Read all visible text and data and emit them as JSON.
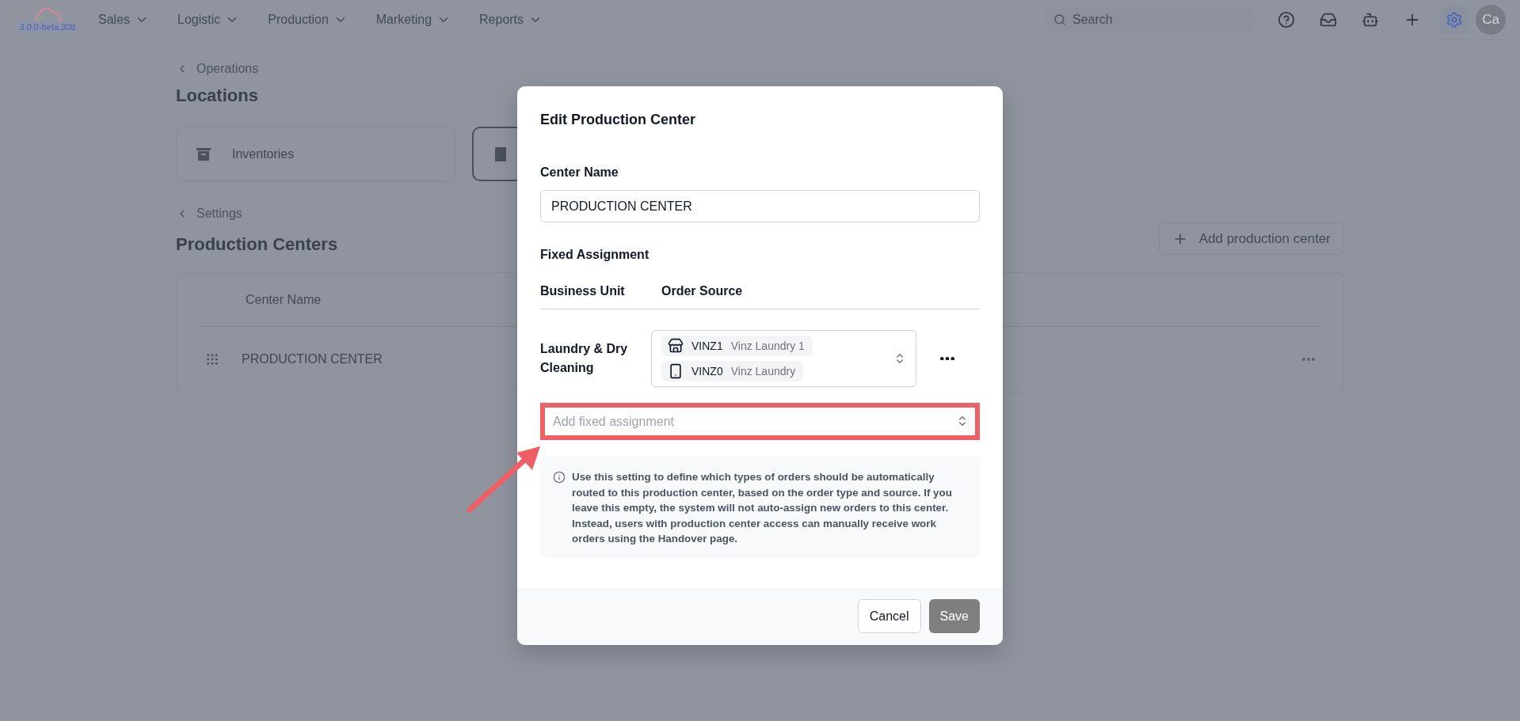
{
  "app": {
    "version": "3.0.0-beta.308"
  },
  "nav": [
    {
      "label": "Sales"
    },
    {
      "label": "Logistic"
    },
    {
      "label": "Production"
    },
    {
      "label": "Marketing"
    },
    {
      "label": "Reports"
    }
  ],
  "search": {
    "placeholder": "Search"
  },
  "toolbar": [
    {
      "selected": false
    },
    {
      "selected": false
    },
    {
      "selected": false
    },
    {
      "selected": false
    },
    {
      "selected": true
    }
  ],
  "user": {
    "initials": "Ca"
  },
  "locations": {
    "breadcrumb": "Operations",
    "title": "Locations",
    "tiles": [
      {
        "label": "Inventories",
        "selected": false
      },
      {
        "selected": true
      }
    ]
  },
  "production_centers": {
    "breadcrumb": "Settings",
    "title": "Production Centers",
    "add_button": "Add production center",
    "columns": [
      "Center Name"
    ],
    "rows": [
      {
        "name": "PRODUCTION CENTER"
      }
    ]
  },
  "dialog": {
    "title": "Edit Production Center",
    "name_label": "Center Name",
    "name_value": "PRODUCTION CENTER",
    "section": "Fixed Assignment",
    "columns": [
      "Business Unit",
      "Order Source"
    ],
    "assignments": [
      {
        "business_unit": "Laundry & Dry Cleaning",
        "sources": [
          {
            "code": "VINZ1",
            "name": "Vinz Laundry 1"
          },
          {
            "code": "VINZ0",
            "name": "Vinz Laundry"
          }
        ]
      }
    ],
    "add_placeholder": "Add fixed assignment",
    "add_highlighted": true,
    "info": "Use this setting to define which types of orders should be automatically routed to this production center, based on the order type and source. If you leave this empty, the system will not auto-assign new orders to this center. Instead, users with production center access can manually receive work orders using the Handover page.",
    "buttons": [
      {
        "label": "Cancel",
        "kind": "secondary",
        "disabled": false
      },
      {
        "label": "Save",
        "kind": "primary",
        "disabled": true
      }
    ]
  }
}
